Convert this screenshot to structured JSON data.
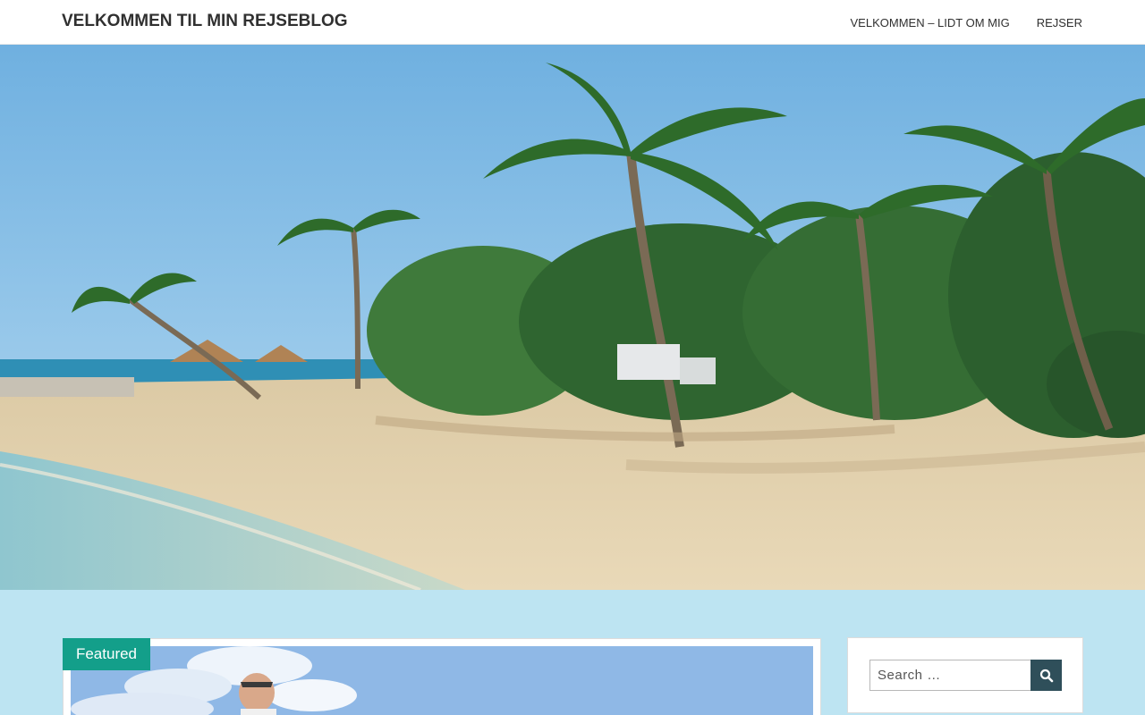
{
  "header": {
    "site_title": "VELKOMMEN TIL MIN REJSEBLOG",
    "nav": [
      {
        "label": "VELKOMMEN – LIDT OM MIG"
      },
      {
        "label": "REJSER"
      }
    ]
  },
  "hero": {
    "alt": "tropical beach with palm trees"
  },
  "main": {
    "featured_badge": "Featured"
  },
  "sidebar": {
    "search": {
      "placeholder": "Search …",
      "button_icon": "search-icon"
    }
  },
  "colors": {
    "accent": "#139f8a",
    "page_background": "#bde4f2",
    "search_button": "#2f4f5a"
  }
}
